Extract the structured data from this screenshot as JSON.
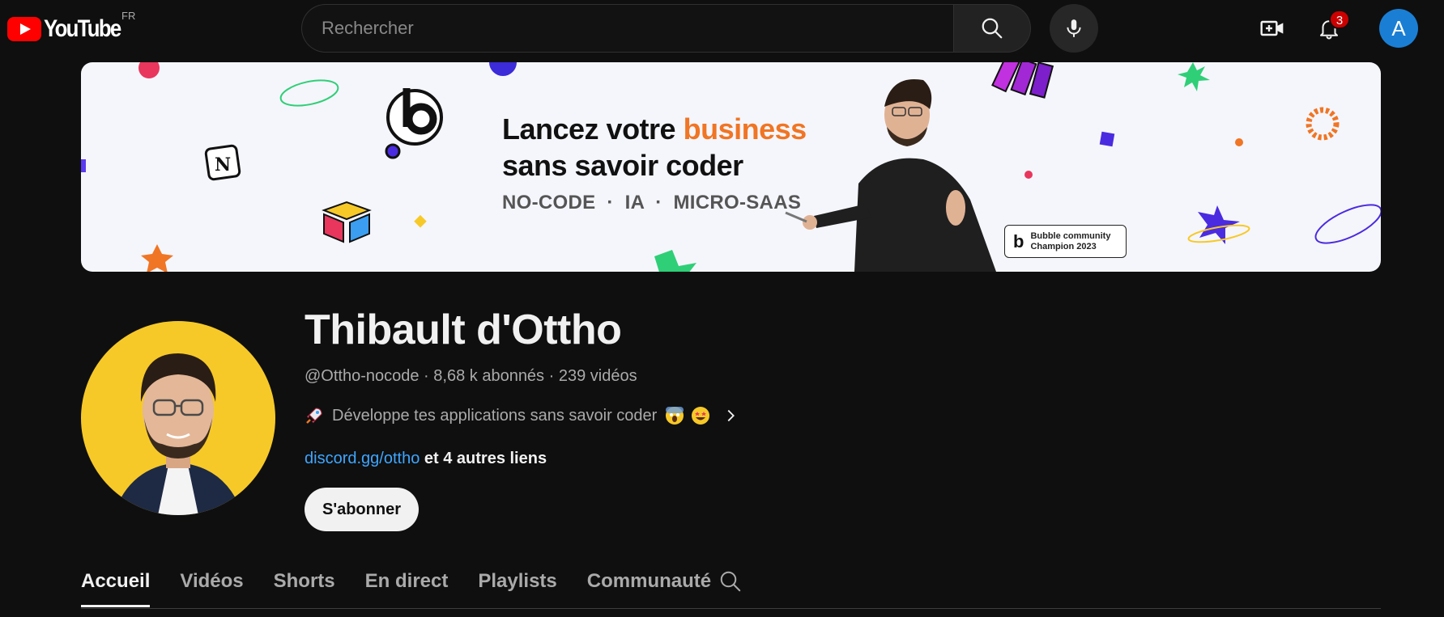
{
  "header": {
    "logo_text": "YouTube",
    "country_code": "FR",
    "search_placeholder": "Rechercher",
    "notification_count": "3",
    "account_initial": "A"
  },
  "banner": {
    "headline_part1": "Lancez votre ",
    "headline_accent": "business",
    "headline_line2": "sans savoir coder",
    "tags": "NO-CODE  ·  IA  ·  MICRO-SAAS",
    "badge_text": "Bubble community\nChampion 2023",
    "badge_logo": "b",
    "accent_color": "#f07524"
  },
  "channel": {
    "name": "Thibault d'Ottho",
    "handle": "@Ottho-nocode",
    "subscribers": "8,68 k abonnés",
    "video_count": "239 vidéos",
    "meta_separator": " · ",
    "description": "Développe tes applications sans savoir coder",
    "link_main": "discord.gg/ottho",
    "link_more": "et 4 autres liens",
    "subscribe_label": "S'abonner"
  },
  "tabs": [
    {
      "label": "Accueil",
      "active": true
    },
    {
      "label": "Vidéos",
      "active": false
    },
    {
      "label": "Shorts",
      "active": false
    },
    {
      "label": "En direct",
      "active": false
    },
    {
      "label": "Playlists",
      "active": false
    },
    {
      "label": "Communauté",
      "active": false
    }
  ],
  "icons": {
    "search": "search-icon",
    "mic": "mic-icon",
    "create": "create-video-icon",
    "notifications": "bell-icon",
    "description_more": "chevron-right-icon",
    "tab_search": "search-icon"
  },
  "colors": {
    "background": "#0f0f0f",
    "youtube_red": "#ff0000",
    "link_blue": "#3ea6ff",
    "avatar_yellow": "#f7c928",
    "account_blue": "#1a7fd4"
  }
}
